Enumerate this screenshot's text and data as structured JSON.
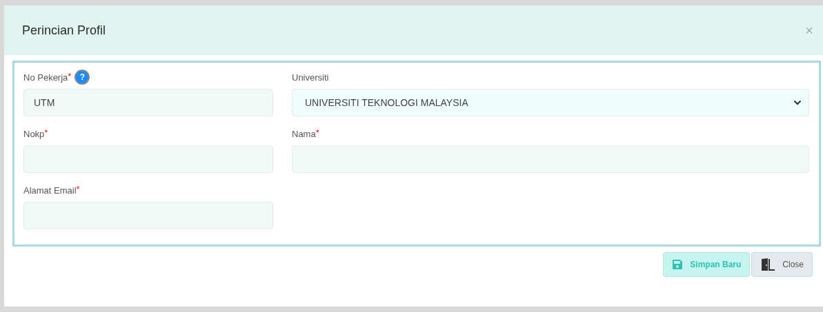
{
  "dialog": {
    "title": "Perincian Profil",
    "close": "×"
  },
  "fields": [
    {
      "kind": "text",
      "label": "No Pekerja",
      "required_mark": "*",
      "help": "?",
      "value": "UTM"
    },
    {
      "kind": "select",
      "label": "Universiti",
      "value": "UNIVERSITI TEKNOLOGI MALAYSIA"
    },
    {
      "kind": "text",
      "label": "Nokp",
      "required_mark": "*"
    },
    {
      "kind": "text",
      "label": "Nama",
      "required_mark": "*"
    },
    {
      "kind": "text",
      "label": "Alamat Email",
      "required_mark": "*"
    }
  ],
  "buttons": [
    {
      "kind": "save",
      "label": "Simpan Baru"
    },
    {
      "kind": "close",
      "label": "Close"
    }
  ]
}
